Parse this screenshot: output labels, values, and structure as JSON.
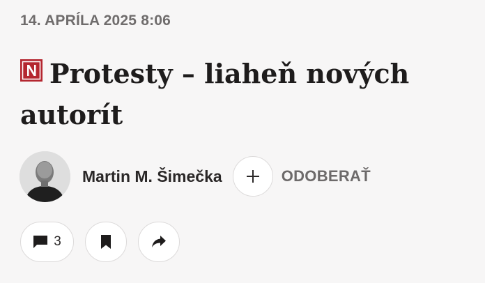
{
  "article": {
    "date": "14. APRÍLA 2025 8:06",
    "title": "Protesty – liaheň nových autorít",
    "brand_logo_letter": "N",
    "brand_color": "#b4262f"
  },
  "author": {
    "name": "Martin M. Šimečka",
    "follow_label": "ODOBERAŤ"
  },
  "actions": {
    "comment_count": "3",
    "icons": [
      "comment-icon",
      "bookmark-icon",
      "share-icon"
    ]
  }
}
